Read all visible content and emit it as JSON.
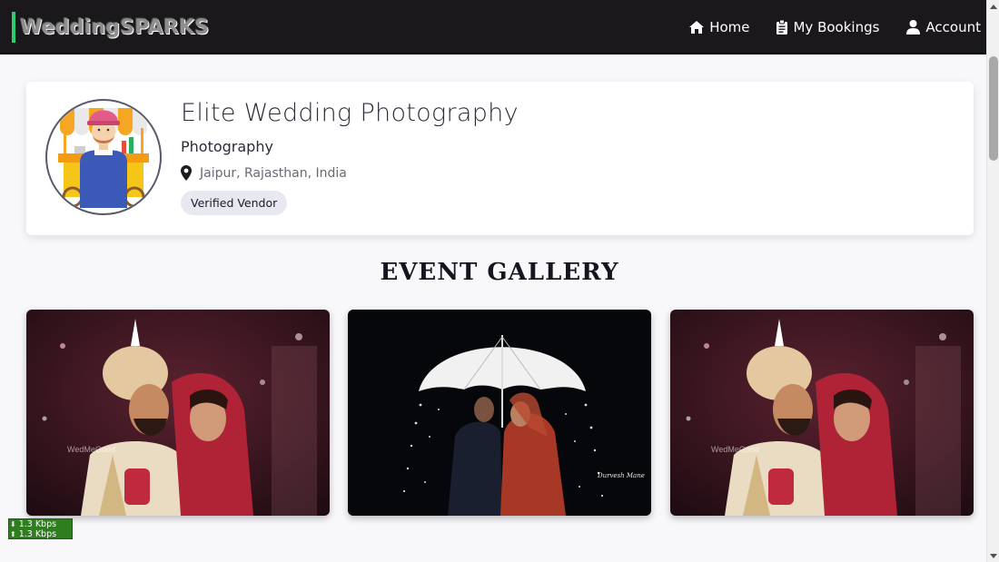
{
  "nav": {
    "brand": "WeddingSPARKS",
    "links": [
      {
        "label": "Home",
        "icon": "home-icon"
      },
      {
        "label": "My Bookings",
        "icon": "clipboard-icon"
      },
      {
        "label": "Account",
        "icon": "user-icon"
      }
    ]
  },
  "vendor": {
    "name": "Elite Wedding Photography",
    "category": "Photography",
    "location": "Jaipur, Rajasthan, India",
    "badge": "Verified Vendor",
    "avatar_icon": "vendor-cart-avatar"
  },
  "gallery": {
    "title": "EVENT GALLERY",
    "images": [
      {
        "subject": "couple-portrait",
        "watermark": "WedMeGood"
      },
      {
        "subject": "couple-under-umbrella",
        "signature": "Durvesh Mane"
      },
      {
        "subject": "couple-portrait",
        "watermark": "WedMeGood"
      }
    ]
  },
  "speed_widget": {
    "download": "1.3 Kbps",
    "upload": "1.3 Kbps"
  },
  "colors": {
    "navbar_bg": "#1a181b",
    "brand_accent": "#2ecc71",
    "page_bg": "#f8f8fb",
    "badge_bg": "#e8e9f0"
  }
}
